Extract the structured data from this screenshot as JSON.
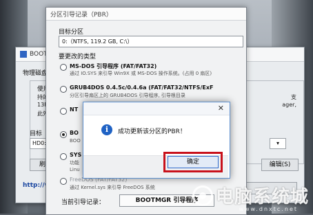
{
  "bootice": {
    "title": "BOOT",
    "tab": "物理磁盘",
    "group_label": "使用",
    "lines_left": [
      "持的",
      "13F9",
      "此外"
    ],
    "lines_right": [
      "支",
      "ager,",
      "ager,"
    ],
    "right_column": [
      "支",
      "ager,",
      "…"
    ],
    "target_label": "目标",
    "disk_value": "HD0:",
    "refresh_button": "刷新",
    "edit_button": "编辑(S)",
    "url_text": "http://w",
    "dropdown_arrow": "▾"
  },
  "pbr_dialog": {
    "title": "分区引导记录（PBR）",
    "target_partition_label": "目标分区",
    "target_partition_value": "0:（NTFS, 119.2 GB, C:\\）",
    "group_label": "要更改的类型",
    "options": [
      {
        "name": "MS-DOS 引导程序 (FAT/FAT32)",
        "desc": "通过 IO.SYS 来引导 Win9X 或 MS-DOS 操作系统。(占用 0 扇区)",
        "selected": false,
        "enabled": true
      },
      {
        "name": "GRUB4DOS 0.4.5c/0.4.6a (FAT/FAT32/NTFS/ExF",
        "desc": "分区引导扇区上的 GRUB4DOS 引导程序, 引导根目录",
        "selected": false,
        "enabled": true
      },
      {
        "name": "NT",
        "desc": "",
        "selected": false,
        "enabled": true
      },
      {
        "name": "BO",
        "desc": "BOO",
        "selected": true,
        "enabled": true
      },
      {
        "name": "SYS",
        "desc": "功能",
        "selected": false,
        "enabled": true
      },
      {
        "name": "FreeDOS (FAT/FAT32)",
        "desc": "通过 Kernel.sys 来引导 FreeDOS 系统",
        "selected": false,
        "enabled": false
      }
    ],
    "extra_line": "Linu",
    "current_label": "当前引导记录：",
    "current_value": "BOOTMGR 引导程序"
  },
  "message_box": {
    "close_glyph": "✕",
    "info_glyph": "i",
    "text": "成功更新该分区的PBR！",
    "ok_button": "确定"
  },
  "watermark": {
    "text": "电脑系统城",
    "url": "www.dnxtc.net"
  },
  "colors": {
    "highlight_box": "#c8111b",
    "info_icon": "#1f62c4",
    "link": "#1a46a0"
  }
}
